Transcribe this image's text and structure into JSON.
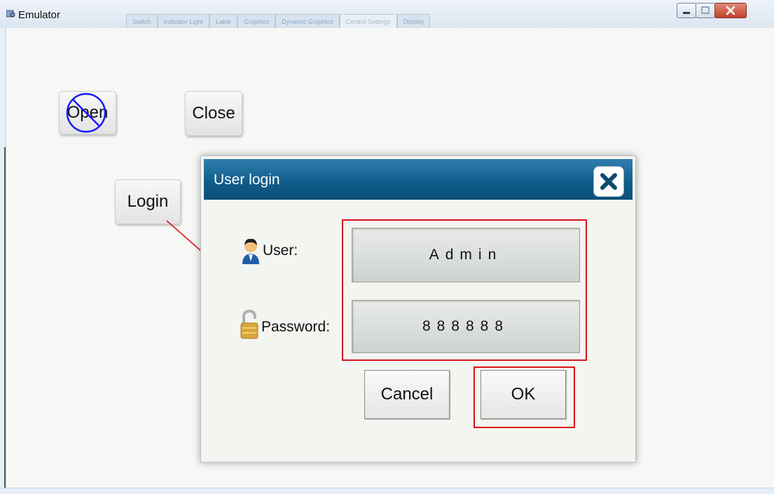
{
  "window": {
    "title": "Emulator",
    "tabs": [
      "Switch",
      "Indicator Light",
      "Lable",
      "Graphics",
      "Dynamic Graphics",
      "Control Settings",
      "Display"
    ],
    "active_tab_index": 5
  },
  "buttons": {
    "open_label": "Open",
    "close_label": "Close",
    "login_label": "Login"
  },
  "dialog": {
    "title": "User login",
    "user_label": "User:",
    "password_label": "Password:",
    "user_value": "Admin",
    "password_value": "888888",
    "cancel_label": "Cancel",
    "ok_label": "OK"
  },
  "colors": {
    "accent_header": "#0e5b88",
    "highlight": "#d8141b",
    "prohibit": "#1a1aff"
  }
}
